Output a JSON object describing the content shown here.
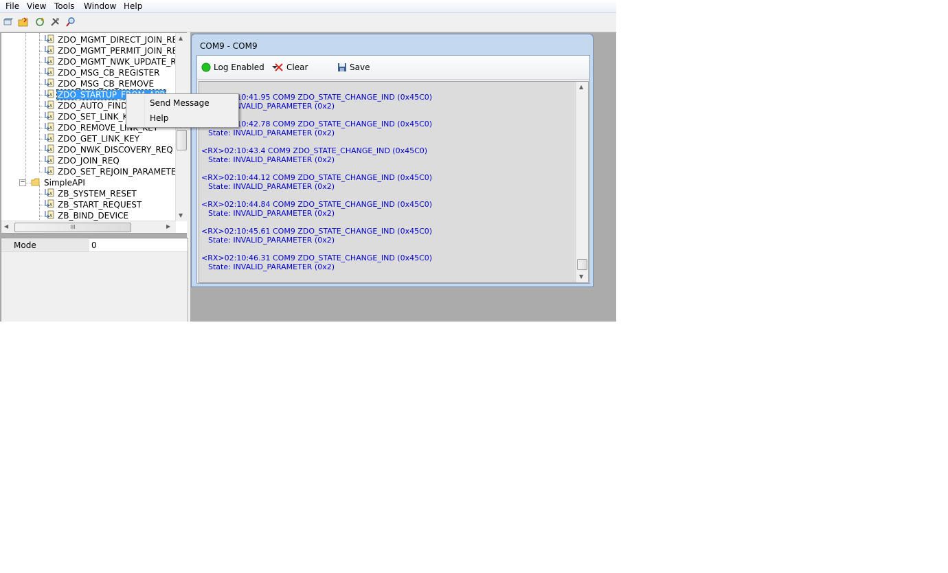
{
  "menubar": {
    "items": [
      "File",
      "View",
      "Tools",
      "Window",
      "Help"
    ]
  },
  "toolbar": {
    "buttons": [
      "new-device-icon",
      "open-folder-icon",
      "refresh-icon",
      "tools-icon",
      "search-device-icon"
    ]
  },
  "tree": {
    "items": [
      {
        "label": "ZDO_MGMT_DIRECT_JOIN_RE",
        "type": "message"
      },
      {
        "label": "ZDO_MGMT_PERMIT_JOIN_RE",
        "type": "message"
      },
      {
        "label": "ZDO_MGMT_NWK_UPDATE_R",
        "type": "message"
      },
      {
        "label": "ZDO_MSG_CB_REGISTER",
        "type": "message"
      },
      {
        "label": "ZDO_MSG_CB_REMOVE",
        "type": "message"
      },
      {
        "label": "ZDO_STARTUP_FROM_APP",
        "type": "message",
        "selected": true
      },
      {
        "label": "ZDO_AUTO_FIND_DESTINATION",
        "type": "message"
      },
      {
        "label": "ZDO_SET_LINK_KEY",
        "type": "message"
      },
      {
        "label": "ZDO_REMOVE_LINK_KEY",
        "type": "message"
      },
      {
        "label": "ZDO_GET_LINK_KEY",
        "type": "message"
      },
      {
        "label": "ZDO_NWK_DISCOVERY_REQ",
        "type": "message"
      },
      {
        "label": "ZDO_JOIN_REQ",
        "type": "message"
      },
      {
        "label": "ZDO_SET_REJOIN_PARAMETERS",
        "type": "message"
      },
      {
        "label": "SimpleAPI",
        "type": "folder"
      },
      {
        "label": "ZB_SYSTEM_RESET",
        "type": "message"
      },
      {
        "label": "ZB_START_REQUEST",
        "type": "message"
      },
      {
        "label": "ZB_BIND_DEVICE",
        "type": "message"
      }
    ],
    "hscroll_thumb_label": "III"
  },
  "properties": {
    "rows": [
      {
        "name": "Mode",
        "value": "0"
      }
    ]
  },
  "child_window": {
    "title": "COM9 - COM9",
    "log_enabled_label": "Log Enabled",
    "clear_label": "Clear",
    "save_label": "Save"
  },
  "log": {
    "entries": [
      {
        "line1": "<RX>02:10:41.95 COM9 ZDO_STATE_CHANGE_IND (0x45C0)",
        "line2": "State: INVALID_PARAMETER (0x2)"
      },
      {
        "line1": "<RX>02:10:42.78 COM9 ZDO_STATE_CHANGE_IND (0x45C0)",
        "line2": "State: INVALID_PARAMETER (0x2)"
      },
      {
        "line1": "<RX>02:10:43.4 COM9 ZDO_STATE_CHANGE_IND (0x45C0)",
        "line2": "State: INVALID_PARAMETER (0x2)"
      },
      {
        "line1": "<RX>02:10:44.12 COM9 ZDO_STATE_CHANGE_IND (0x45C0)",
        "line2": "State: INVALID_PARAMETER (0x2)"
      },
      {
        "line1": "<RX>02:10:44.84 COM9 ZDO_STATE_CHANGE_IND (0x45C0)",
        "line2": "State: INVALID_PARAMETER (0x2)"
      },
      {
        "line1": "<RX>02:10:45.61 COM9 ZDO_STATE_CHANGE_IND (0x45C0)",
        "line2": "State: INVALID_PARAMETER (0x2)"
      },
      {
        "line1": "<RX>02:10:46.31 COM9 ZDO_STATE_CHANGE_IND (0x45C0)",
        "line2": "State: INVALID_PARAMETER (0x2)"
      }
    ]
  },
  "context_menu": {
    "items": [
      "Send Message",
      "Help"
    ]
  },
  "colors": {
    "selection": "#3399ff",
    "log_text": "#0000cc",
    "log_enabled_indicator": "#22c322",
    "clear_icon": "#d42a1e",
    "workspace": "#ababab",
    "window_frame": "#c4d8ef"
  }
}
